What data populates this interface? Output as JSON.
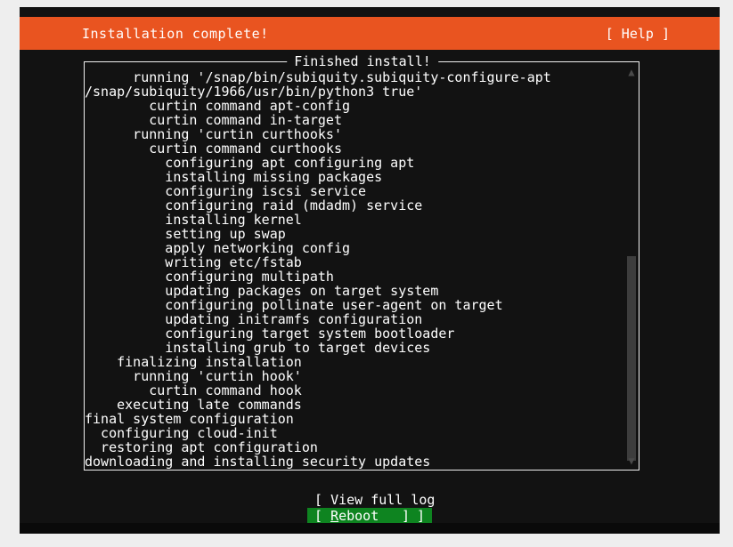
{
  "header": {
    "title": "Installation complete!",
    "help_label": "[ Help ]",
    "accent_color": "#e95420"
  },
  "log_panel": {
    "title": "Finished install!",
    "border_color": "#f0f0f0",
    "lines": [
      "      running '/snap/bin/subiquity.subiquity-configure-apt",
      "/snap/subiquity/1966/usr/bin/python3 true'",
      "        curtin command apt-config",
      "        curtin command in-target",
      "      running 'curtin curthooks'",
      "        curtin command curthooks",
      "          configuring apt configuring apt",
      "          installing missing packages",
      "          configuring iscsi service",
      "          configuring raid (mdadm) service",
      "          installing kernel",
      "          setting up swap",
      "          apply networking config",
      "          writing etc/fstab",
      "          configuring multipath",
      "          updating packages on target system",
      "          configuring pollinate user-agent on target",
      "          updating initramfs configuration",
      "          configuring target system bootloader",
      "          installing grub to target devices",
      "    finalizing installation",
      "      running 'curtin hook'",
      "        curtin command hook",
      "    executing late commands",
      "final system configuration",
      "  configuring cloud-init",
      "  restoring apt configuration",
      "downloading and installing security updates"
    ],
    "scrollbar": {
      "up_arrow": "▲",
      "down_arrow": "▼",
      "thumb_color": "#3d3d3d",
      "arrow_color": "#4a4a4a"
    }
  },
  "actions": {
    "view_log": {
      "open_bracket": "[",
      "label": "View full log",
      "close_bracket": "]"
    },
    "reboot": {
      "open_bracket": "[",
      "accel": "R",
      "label": "eboot",
      "close_bracket": "]",
      "selected_color": "#0e8420"
    }
  }
}
